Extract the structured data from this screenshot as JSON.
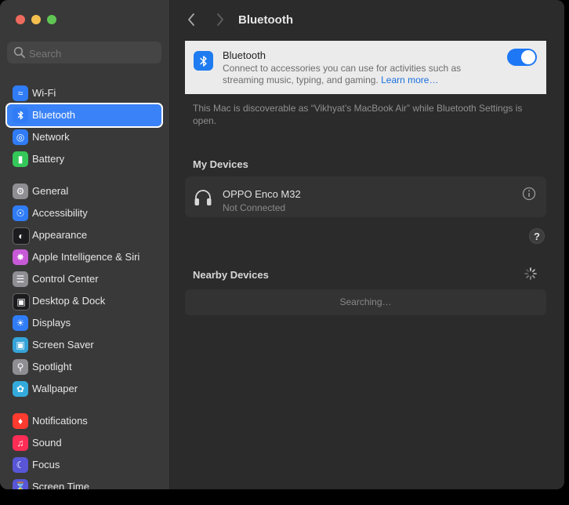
{
  "window": {
    "traffic_lights": [
      "#ed6a5e",
      "#f5bf4f",
      "#61c554"
    ]
  },
  "sidebar": {
    "search_placeholder": "Search",
    "items": [
      {
        "id": "wifi",
        "label": "Wi-Fi",
        "icon": "wifi-icon",
        "color": "#2f7cf6"
      },
      {
        "id": "bluetooth",
        "label": "Bluetooth",
        "icon": "bluetooth-icon",
        "color": "#2f7cf6",
        "selected": true
      },
      {
        "id": "network",
        "label": "Network",
        "icon": "globe-icon",
        "color": "#2f7cf6"
      },
      {
        "id": "battery",
        "label": "Battery",
        "icon": "battery-icon",
        "color": "#34c759"
      },
      {
        "id": "general",
        "label": "General",
        "icon": "gear-icon",
        "color": "#8e8e93"
      },
      {
        "id": "accessibility",
        "label": "Accessibility",
        "icon": "accessibility-icon",
        "color": "#2f7cf6"
      },
      {
        "id": "appearance",
        "label": "Appearance",
        "icon": "appearance-icon",
        "color": "#1c1c1e"
      },
      {
        "id": "apple-intelligence",
        "label": "Apple Intelligence & Siri",
        "icon": "siri-icon",
        "color": "#c85ad8"
      },
      {
        "id": "control-center",
        "label": "Control Center",
        "icon": "control-center-icon",
        "color": "#8e8e93"
      },
      {
        "id": "desktop-dock",
        "label": "Desktop & Dock",
        "icon": "dock-icon",
        "color": "#1c1c1e"
      },
      {
        "id": "displays",
        "label": "Displays",
        "icon": "sun-icon",
        "color": "#2f7cf6"
      },
      {
        "id": "screen-saver",
        "label": "Screen Saver",
        "icon": "screen-saver-icon",
        "color": "#35a3d8"
      },
      {
        "id": "spotlight",
        "label": "Spotlight",
        "icon": "magnifier-icon",
        "color": "#8e8e93"
      },
      {
        "id": "wallpaper",
        "label": "Wallpaper",
        "icon": "wallpaper-icon",
        "color": "#34aadc"
      },
      {
        "id": "notifications",
        "label": "Notifications",
        "icon": "bell-icon",
        "color": "#ff3b30"
      },
      {
        "id": "sound",
        "label": "Sound",
        "icon": "speaker-icon",
        "color": "#ff2d55"
      },
      {
        "id": "focus",
        "label": "Focus",
        "icon": "moon-icon",
        "color": "#5856d6"
      },
      {
        "id": "screen-time",
        "label": "Screen Time",
        "icon": "hourglass-icon",
        "color": "#5856d6"
      }
    ]
  },
  "toolbar": {
    "title": "Bluetooth",
    "back_icon": "chevron-left-icon",
    "forward_icon": "chevron-right-icon"
  },
  "bluetooth": {
    "title": "Bluetooth",
    "description": "Connect to accessories you can use for activities such as streaming music, typing, and gaming.",
    "learn_more": "Learn more…",
    "enabled": true
  },
  "discoverable_text": "This Mac is discoverable as “Vikhyat’s MacBook Air” while Bluetooth Settings is open.",
  "my_devices": {
    "heading": "My Devices",
    "devices": [
      {
        "name": "OPPO Enco M32",
        "status": "Not Connected",
        "icon": "headphones-icon"
      }
    ]
  },
  "help_label": "?",
  "nearby_devices": {
    "heading": "Nearby Devices",
    "status": "Searching…"
  }
}
